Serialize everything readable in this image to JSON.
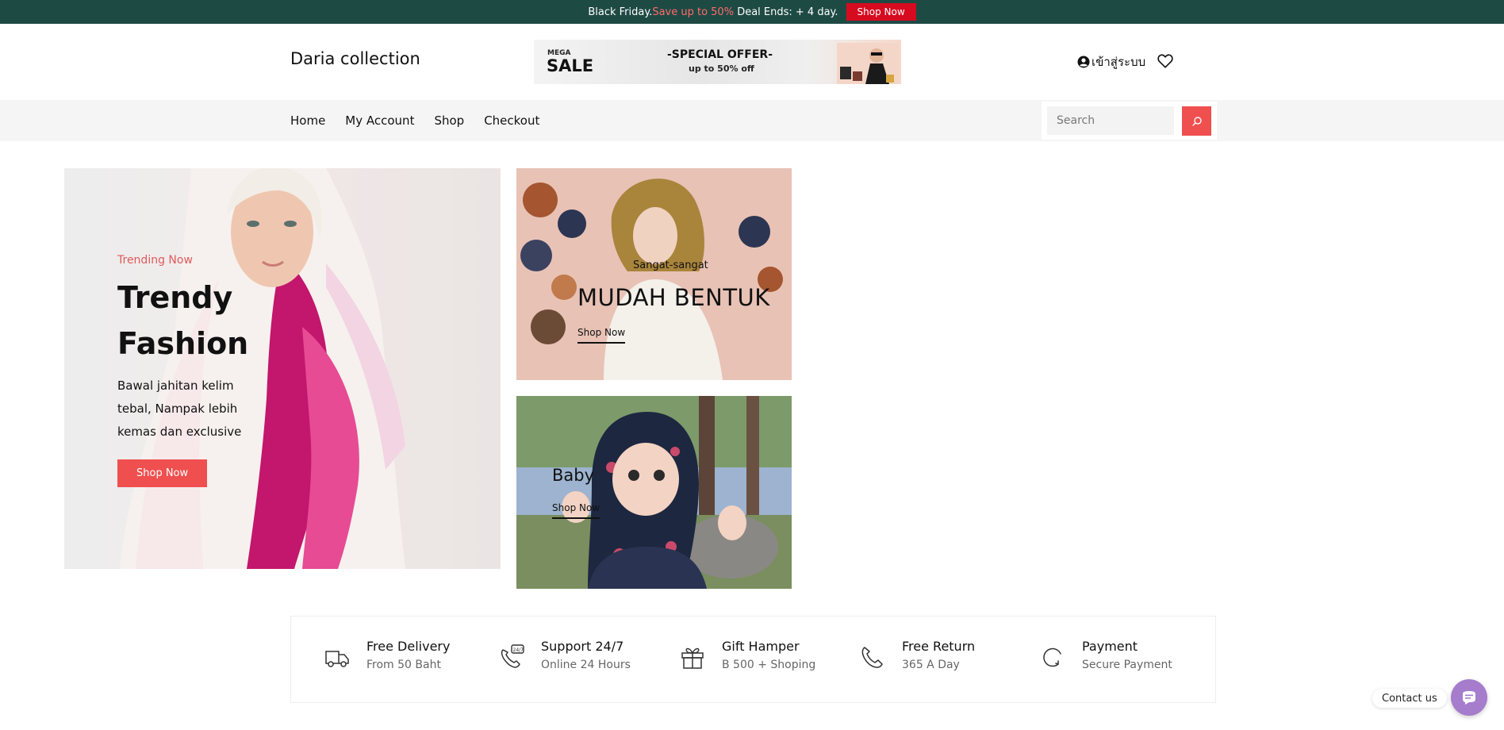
{
  "promo_bar": {
    "lead": "Black Friday.",
    "sale": "Save up to 50%",
    "deal": " Deal Ends: + 4 day.",
    "button": "Shop Now"
  },
  "header": {
    "logo": "Daria collection",
    "banner": {
      "mega": "MEGA",
      "sale": "SALE",
      "special": "-SPECIAL OFFER-",
      "offer": "up to 50% off"
    },
    "login": "เข้าสู่ระบบ"
  },
  "nav": {
    "items": [
      "Home",
      "My Account",
      "Shop",
      "Checkout"
    ],
    "search_placeholder": "Search"
  },
  "hero": {
    "tag": "Trending Now",
    "title": "Trendy Fashion",
    "description": "Bawal jahitan kelim tebal, Nampak lebih kemas dan exclusive",
    "button": "Shop Now"
  },
  "cards": [
    {
      "subtitle": "Sangat-sangat",
      "title": "MUDAH BENTUK",
      "link": "Shop Now"
    },
    {
      "title": "Baby",
      "link": "Shop Now"
    }
  ],
  "features": [
    {
      "icon": "truck-icon",
      "title": "Free Delivery",
      "subtitle": "From 50 Baht"
    },
    {
      "icon": "support-phone-icon",
      "title": "Support 24/7",
      "subtitle": "Online 24 Hours"
    },
    {
      "icon": "gift-icon",
      "title": "Gift Hamper",
      "subtitle": "B 500 + Shoping"
    },
    {
      "icon": "phone-icon",
      "title": "Free Return",
      "subtitle": "365 A Day"
    },
    {
      "icon": "refresh-icon",
      "title": "Payment",
      "subtitle": "Secure Payment"
    }
  ],
  "contact": {
    "label": "Contact us"
  },
  "colors": {
    "topbar": "#1e4a44",
    "accent": "#ef4f4f",
    "promo_button": "#d70b20",
    "contact_button": "#a67ccd"
  }
}
